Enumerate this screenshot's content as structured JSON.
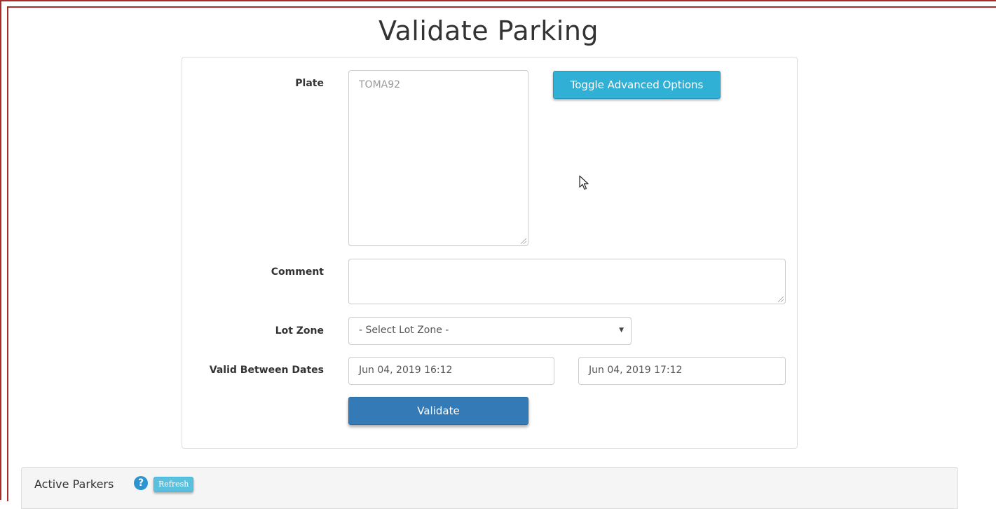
{
  "page": {
    "title": "Validate Parking"
  },
  "form": {
    "plate": {
      "label": "Plate",
      "placeholder": "TOMA92"
    },
    "toggle_advanced_label": "Toggle Advanced Options",
    "comment": {
      "label": "Comment",
      "value": ""
    },
    "lot_zone": {
      "label": "Lot Zone",
      "selected": "- Select Lot Zone -"
    },
    "valid_between": {
      "label": "Valid Between Dates",
      "start": "Jun 04, 2019 16:12",
      "end": "Jun 04, 2019 17:12"
    },
    "validate_label": "Validate"
  },
  "active_parkers": {
    "title": "Active Parkers",
    "help_icon": "question-circle-icon",
    "refresh_label": "Refresh"
  },
  "colors": {
    "border_accent": "#a62d2b",
    "info_button": "#31b0d5",
    "primary_button": "#337ab7"
  }
}
